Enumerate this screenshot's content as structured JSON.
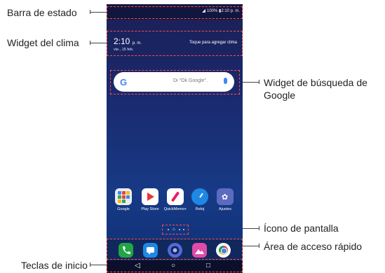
{
  "callouts": {
    "status_bar": "Barra de estado",
    "weather_widget": "Widget del clima",
    "google_search_widget_line1": "Widget de búsqueda de",
    "google_search_widget_line2": "Google",
    "screen_icon": "Ícono de pantalla",
    "quick_access": "Área de acceso rápido",
    "home_keys": "Teclas de inicio"
  },
  "status_bar": {
    "text": "100% ▮2:10 p. m."
  },
  "weather": {
    "time": "2:10",
    "ampm": "p. m.",
    "date": "vie., 15 feb.",
    "tap_text": "Toque para agregar clima"
  },
  "search": {
    "g": "G",
    "hint": "Di \"Ok Google\"."
  },
  "apps": [
    {
      "label": "Google"
    },
    {
      "label": "Play Store"
    },
    {
      "label": "QuickMemo+"
    },
    {
      "label": "Reloj"
    },
    {
      "label": "Ajustes"
    }
  ],
  "nav": {
    "back": "◁",
    "home": "○",
    "recents": "□"
  }
}
